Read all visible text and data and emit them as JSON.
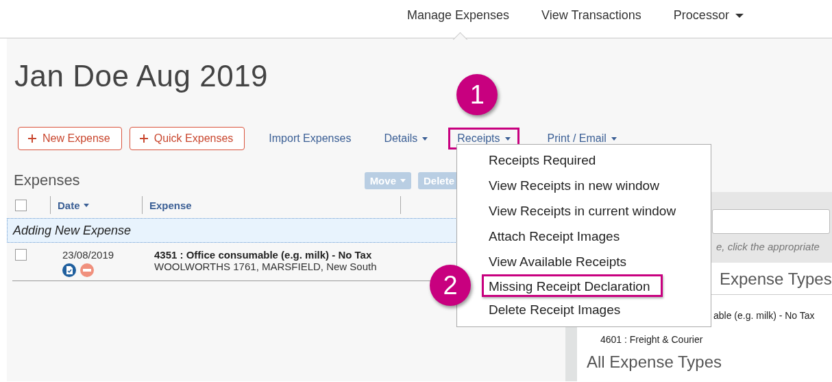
{
  "nav": [
    {
      "label": "Manage Expenses",
      "selected": true,
      "dropdown": false
    },
    {
      "label": "View Transactions",
      "selected": false,
      "dropdown": false
    },
    {
      "label": "Processor",
      "selected": false,
      "dropdown": true
    }
  ],
  "report_title": "Jan Doe Aug 2019",
  "toolbar": [
    {
      "kind": "button",
      "label": "New Expense",
      "dropdown": false,
      "highlighted": false
    },
    {
      "kind": "button",
      "label": "Quick Expenses",
      "dropdown": false,
      "highlighted": false
    },
    {
      "kind": "link",
      "label": "Import Expenses",
      "dropdown": false,
      "highlighted": false
    },
    {
      "kind": "link",
      "label": "Details",
      "dropdown": true,
      "highlighted": false
    },
    {
      "kind": "link",
      "label": "Receipts",
      "dropdown": true,
      "highlighted": true,
      "callout": "1"
    },
    {
      "kind": "link",
      "label": "Print / Email",
      "dropdown": true,
      "highlighted": false
    }
  ],
  "expenses": {
    "title": "Expenses",
    "actions": [
      {
        "label": "Move",
        "dropdown": true,
        "disabled": true
      },
      {
        "label": "Delete",
        "dropdown": false,
        "disabled": true
      }
    ],
    "select_all_checked": false,
    "columns": [
      {
        "label": "Date",
        "sorted": true
      },
      {
        "label": "Expense",
        "sorted": false
      }
    ],
    "adding_row": "Adding New Expense",
    "rows": [
      {
        "checked": false,
        "date": "23/08/2019",
        "expense_type": "4351 : Office consumable (e.g. milk) - No Tax",
        "merchant": "WOOLWORTHS 1761, MARSFIELD, New South"
      }
    ]
  },
  "receipts_menu": [
    {
      "label": "Receipts Required",
      "highlighted": false
    },
    {
      "label": "View Receipts in new window",
      "highlighted": false
    },
    {
      "label": "View Receipts in current window",
      "highlighted": false
    },
    {
      "label": "Attach Receipt Images",
      "highlighted": false
    },
    {
      "label": "View Available Receipts",
      "highlighted": false
    },
    {
      "label": "Missing Receipt Declaration",
      "highlighted": true,
      "callout": "2"
    },
    {
      "label": "Delete Receipt Images",
      "highlighted": false
    }
  ],
  "expense_type_panel": {
    "hint": "e, click the appropriate",
    "section_title": "Expense Types",
    "items": [
      {
        "label": "able (e.g. milk) - No Tax",
        "clipped": true
      },
      {
        "label": "4601 : Freight & Courier",
        "clipped": false
      }
    ],
    "all_title": "All Expense Types"
  }
}
